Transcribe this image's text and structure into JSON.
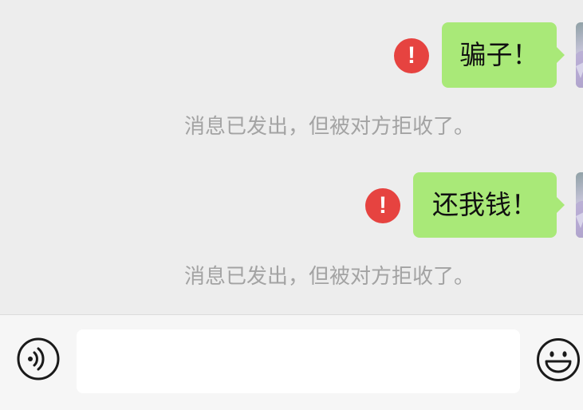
{
  "messages": [
    {
      "text": "骗子！",
      "status_icon": "error-exclamation-icon",
      "notice": "消息已发出，但被对方拒收了。"
    },
    {
      "text": "还我钱！",
      "status_icon": "error-exclamation-icon",
      "notice": "消息已发出，但被对方拒收了。"
    }
  ],
  "error_glyph": "!",
  "input_bar": {
    "voice_icon": "voice-icon",
    "input_value": "",
    "emoji_icon": "emoji-icon"
  },
  "colors": {
    "background": "#ededed",
    "bubble": "#a9e978",
    "error": "#e64340",
    "notice_text": "#a3a3a3",
    "input_bar": "#f6f6f6"
  }
}
